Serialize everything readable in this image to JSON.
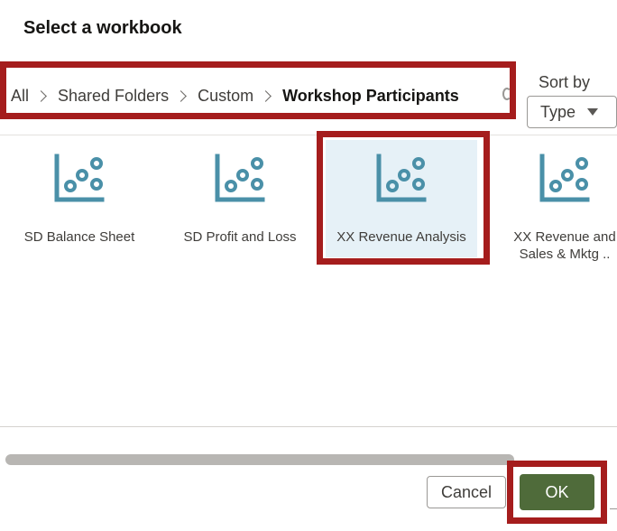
{
  "dialog": {
    "title": "Select a workbook"
  },
  "breadcrumb": {
    "items": [
      "All",
      "Shared Folders",
      "Custom",
      "Workshop Participants"
    ]
  },
  "sort": {
    "label": "Sort by",
    "value": "Type"
  },
  "workbooks": [
    {
      "label": "SD Balance Sheet",
      "selected": false
    },
    {
      "label": "SD Profit and Loss",
      "selected": false
    },
    {
      "label": "XX Revenue Analysis",
      "selected": true
    },
    {
      "label_line1": "XX Revenue and",
      "label_line2": "Sales & Mktg ..",
      "selected": false
    }
  ],
  "icons": {
    "workbook": "scatter-chart-icon",
    "separator": "chevron-right-icon",
    "dropdown": "caret-down-icon"
  },
  "buttons": {
    "cancel": "Cancel",
    "ok": "OK"
  },
  "colors": {
    "accent": "#4f6b3a",
    "icon": "#4a90a8",
    "selected_bg": "#e6f1f7",
    "highlight": "#a51d1d"
  }
}
